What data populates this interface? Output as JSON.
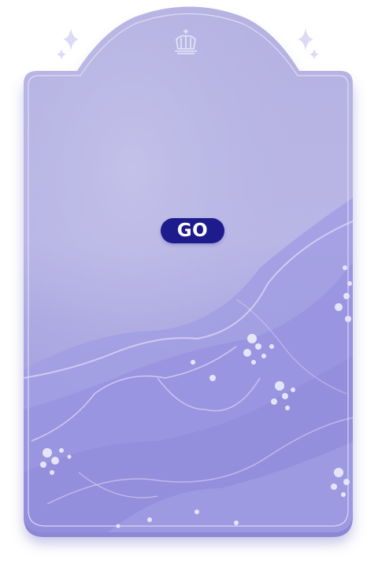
{
  "screen": {
    "go_button_label": "GO"
  },
  "icons": {
    "crown": "crown-icon",
    "sparkle_left": "sparkle-icon",
    "sparkle_right": "sparkle-icon"
  },
  "colors": {
    "card_base": "#b7b4e3",
    "card_marble": "#9a97dd",
    "card_edge": "#8f8bd5",
    "button_bg": "#1e1b8c",
    "button_text": "#ffffff",
    "ornament": "#e8e7fa"
  }
}
